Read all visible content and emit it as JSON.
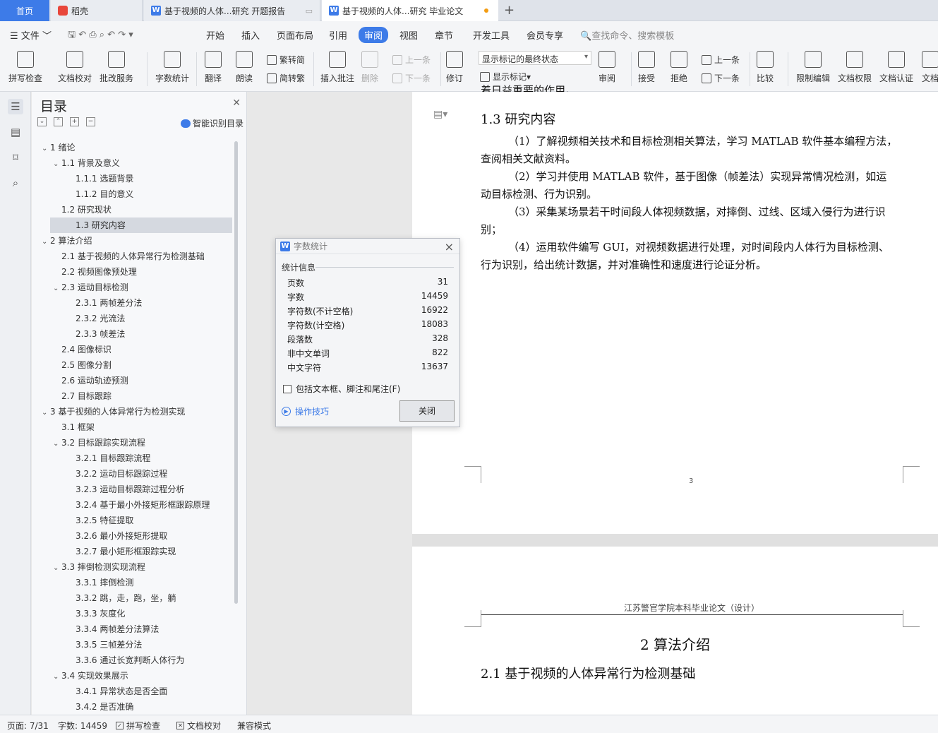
{
  "tabs": {
    "home": "首页",
    "t1": "稻壳",
    "t2": "基于视频的人体...研究 开题报告",
    "t3": "基于视频的人体...研究 毕业论文"
  },
  "menu": {
    "file": "文件",
    "items": [
      "开始",
      "插入",
      "页面布局",
      "引用",
      "审阅",
      "视图",
      "章节",
      "开发工具",
      "会员专享"
    ],
    "search": "查找命令、搜索模板"
  },
  "toolbar": {
    "spell": "拼写检查",
    "proof": "文档校对",
    "batch": "批改服务",
    "wordcount": "字数统计",
    "translate": "翻译",
    "read": "朗读",
    "trad": "繁转简",
    "simp": "简转繁",
    "insert_comment": "插入批注",
    "delete": "删除",
    "prev": "上一条",
    "next": "下一条",
    "revise": "修订",
    "markup_state": "显示标记的最终状态",
    "show_markup": "显示标记",
    "review": "审阅",
    "accept": "接受",
    "reject": "拒绝",
    "prev2": "上一条",
    "next2": "下一条",
    "compare": "比较",
    "restrict": "限制编辑",
    "perm": "文档权限",
    "cert": "文档认证",
    "more": "文档"
  },
  "nav": {
    "title": "目录",
    "smart": "智能识别目录",
    "items": [
      {
        "t": "1  绪论",
        "lv": 0,
        "c": "﹀"
      },
      {
        "t": "1.1  背景及意义",
        "lv": 1,
        "c": "﹀"
      },
      {
        "t": "1.1.1 选题背景",
        "lv": 2,
        "c": ""
      },
      {
        "t": "1.1.2 目的意义",
        "lv": 2,
        "c": ""
      },
      {
        "t": "1.2  研究现状",
        "lv": 1,
        "c": ""
      },
      {
        "t": "1.3  研究内容",
        "lv": 1,
        "c": ""
      },
      {
        "t": "2  算法介绍",
        "lv": 0,
        "c": "﹀"
      },
      {
        "t": "2.1  基于视频的人体异常行为检测基础",
        "lv": 1,
        "c": ""
      },
      {
        "t": "2.2  视频图像预处理",
        "lv": 1,
        "c": ""
      },
      {
        "t": "2.3  运动目标检测",
        "lv": 1,
        "c": "﹀"
      },
      {
        "t": "2.3.1  两帧差分法",
        "lv": 2,
        "c": ""
      },
      {
        "t": "2.3.2  光流法",
        "lv": 2,
        "c": ""
      },
      {
        "t": "2.3.3  帧差法",
        "lv": 2,
        "c": ""
      },
      {
        "t": "2.4  图像标识",
        "lv": 1,
        "c": ""
      },
      {
        "t": "2.5  图像分割",
        "lv": 1,
        "c": ""
      },
      {
        "t": "2.6  运动轨迹预测",
        "lv": 1,
        "c": ""
      },
      {
        "t": "2.7  目标跟踪",
        "lv": 1,
        "c": ""
      },
      {
        "t": "3  基于视频的人体异常行为检测实现",
        "lv": 0,
        "c": "﹀"
      },
      {
        "t": "3.1  框架",
        "lv": 1,
        "c": ""
      },
      {
        "t": "3.2  目标跟踪实现流程",
        "lv": 1,
        "c": "﹀"
      },
      {
        "t": "3.2.1 目标跟踪流程",
        "lv": 2,
        "c": ""
      },
      {
        "t": "3.2.2  运动目标跟踪过程",
        "lv": 2,
        "c": ""
      },
      {
        "t": "3.2.3  运动目标跟踪过程分析",
        "lv": 2,
        "c": ""
      },
      {
        "t": "3.2.4 基于最小外接矩形框跟踪原理",
        "lv": 2,
        "c": ""
      },
      {
        "t": "3.2.5 特征提取",
        "lv": 2,
        "c": ""
      },
      {
        "t": "3.2.6  最小外接矩形提取",
        "lv": 2,
        "c": ""
      },
      {
        "t": "3.2.7 最小矩形框跟踪实现",
        "lv": 2,
        "c": ""
      },
      {
        "t": "3.3  摔倒检测实现流程",
        "lv": 1,
        "c": "﹀"
      },
      {
        "t": "3.3.1 摔倒检测",
        "lv": 2,
        "c": ""
      },
      {
        "t": "3.3.2  跳，走，跑，坐，躺",
        "lv": 2,
        "c": ""
      },
      {
        "t": "3.3.3  灰度化",
        "lv": 2,
        "c": ""
      },
      {
        "t": "3.3.4  两帧差分法算法",
        "lv": 2,
        "c": ""
      },
      {
        "t": "3.3.5  三帧差分法",
        "lv": 2,
        "c": ""
      },
      {
        "t": "3.3.6  通过长宽判断人体行为",
        "lv": 2,
        "c": ""
      },
      {
        "t": "3.4 实现效果展示",
        "lv": 1,
        "c": "﹀"
      },
      {
        "t": "3.4.1 异常状态是否全面",
        "lv": 2,
        "c": ""
      },
      {
        "t": "3.4.2  是否准确",
        "lv": 2,
        "c": ""
      }
    ]
  },
  "doc": {
    "top_cut": "着日益重要的作用。",
    "h13": "1.3  研究内容",
    "p1a": "（1）了解视频相关技术和目标检测相关算法，学习 MATLAB 软件基本编程方法，",
    "p1b": "查阅相关文献资料。",
    "p2a": "（2）学习并使用 MATLAB 软件，基于图像（帧差法）实现异常情况检测，如运",
    "p2b": "动目标检测、行为识别。",
    "p3a": "（3）采集某场景若干时间段人体视频数据，对摔倒、过线、区域入侵行为进行识",
    "p3b": "别；",
    "p4a": "（4）运用软件编写 GUI，对视频数据进行处理，对时间段内人体行为目标检测、",
    "p4b": "行为识别，给出统计数据，并对准确性和速度进行论证分析。",
    "page_num": "3",
    "header": "江苏警官学院本科毕业论文（设计）",
    "h2": "2  算法介绍",
    "h21": "2.1  基于视频的人体异常行为检测基础"
  },
  "dialog": {
    "title": "字数统计",
    "group": "统计信息",
    "rows": [
      {
        "k": "页数",
        "v": "31"
      },
      {
        "k": "字数",
        "v": "14459"
      },
      {
        "k": "字符数(不计空格)",
        "v": "16922"
      },
      {
        "k": "字符数(计空格)",
        "v": "18083"
      },
      {
        "k": "段落数",
        "v": "328"
      },
      {
        "k": "非中文单词",
        "v": "822"
      },
      {
        "k": "中文字符",
        "v": "13637"
      }
    ],
    "checkbox": "包括文本框、脚注和尾注(F)",
    "tip": "操作技巧",
    "close": "关闭"
  },
  "status": {
    "page": "页面: 7/31",
    "words": "字数: 14459",
    "spell": "拼写检查",
    "proof": "文档校对",
    "compat": "兼容模式"
  }
}
